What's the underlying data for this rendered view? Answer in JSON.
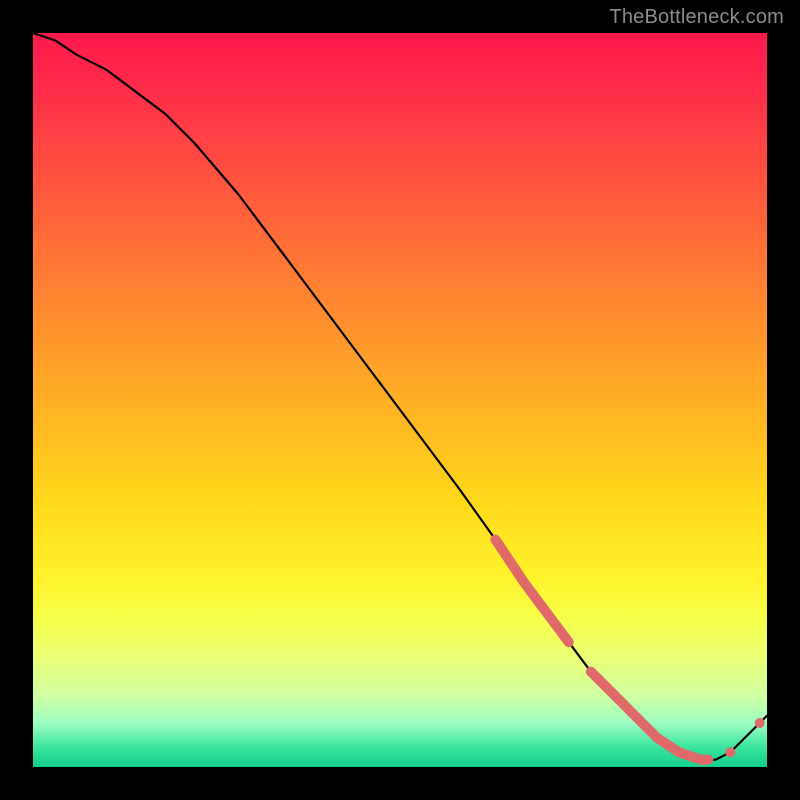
{
  "watermark": "TheBottleneck.com",
  "chart_data": {
    "type": "line",
    "title": "",
    "xlabel": "",
    "ylabel": "",
    "xlim": [
      0,
      100
    ],
    "ylim": [
      0,
      100
    ],
    "grid": false,
    "legend": false,
    "series": [
      {
        "name": "bottleneck-curve",
        "stroke": "#000000",
        "x": [
          0,
          3,
          6,
          10,
          14,
          18,
          22,
          28,
          34,
          40,
          46,
          52,
          58,
          63,
          67,
          70,
          73,
          76,
          79,
          82,
          85,
          88,
          91,
          93,
          95,
          97,
          99,
          100
        ],
        "values": [
          100,
          99,
          97,
          95,
          92,
          89,
          85,
          78,
          70,
          62,
          54,
          46,
          38,
          31,
          25,
          21,
          17,
          13,
          10,
          7,
          4,
          2,
          1,
          1,
          2,
          4,
          6,
          7
        ]
      }
    ],
    "highlight_segments": [
      {
        "range_x": [
          63,
          73
        ],
        "color": "#e06a6a",
        "note": "steep-descent-cluster"
      },
      {
        "range_x": [
          76,
          92
        ],
        "color": "#e06a6a",
        "note": "valley-floor-cluster"
      },
      {
        "range_x": [
          95,
          99
        ],
        "color": "#e06a6a",
        "note": "uptick-dots"
      }
    ],
    "colors": {
      "gradient_top": "#ff1a4b",
      "gradient_mid": "#ffd91a",
      "gradient_bottom": "#14cf8c",
      "frame": "#000000",
      "curve": "#000000",
      "marker": "#e06a6a"
    }
  }
}
